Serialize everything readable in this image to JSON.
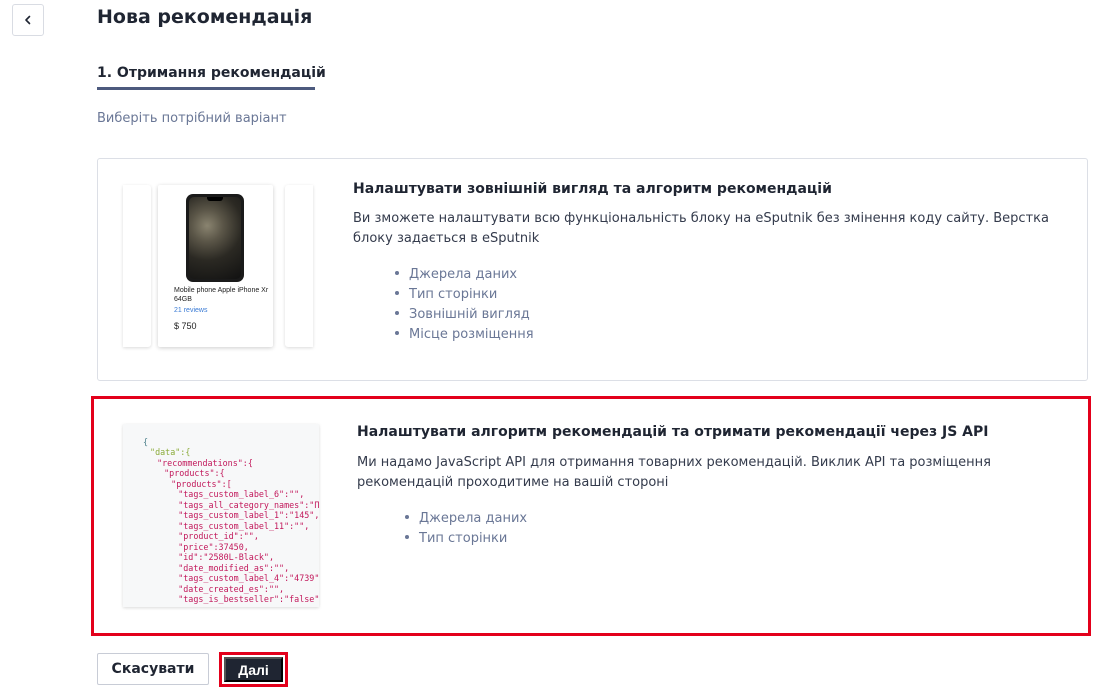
{
  "page": {
    "title": "Нова рекомендація",
    "step_tab": "1. Отримання рекомендацій",
    "hint": "Виберіть потрібний варіант"
  },
  "options": [
    {
      "title": "Налаштувати зовнішній вигляд та алгоритм рекомендацій",
      "description": "Ви зможете налаштувати всю функціональність блоку на eSputnik без змінення коду сайту. Верстка блоку задається в eSputnik",
      "features": [
        "Джерела даних",
        "Тип сторінки",
        "Зовнішній вигляд",
        "Місце розміщення"
      ],
      "preview": {
        "product_name": "Mobile phone Apple iPhone Xr 64GB",
        "reviews": "21 reviews",
        "price": "$ 750"
      }
    },
    {
      "title": "Налаштувати алгоритм рекомендацій та отримати рекомендації через JS API",
      "description": "Ми надамо JavaScript API для отримання товарних рекомендацій. Виклик API та розміщення рекомендацій проходитиме на вашій стороні",
      "features": [
        "Джерела даних",
        "Тип сторінки"
      ],
      "code_lines": [
        "{",
        " \"data\":{",
        "  \"recommendations\":{",
        "   \"products\":{",
        "    \"products\":[",
        "     \"tags_custom_label_6\":\"\",",
        "     \"tags_all_category_names\":\"Пу",
        "     \"tags_custom_label_1\":\"145\",",
        "     \"tags_custom_label_11\":\"\",",
        "     \"product_id\":\"\",",
        "     \"price\":37450,",
        "     \"id\":\"2580L-Black\",",
        "     \"date_modified_as\":\"\",",
        "     \"tags_custom_label_4\":\"4739\",",
        "     \"date_created_es\":\"\",",
        "     \"tags_is_bestseller\":\"false\""
      ]
    }
  ],
  "buttons": {
    "cancel": "Скасувати",
    "next": "Далі"
  },
  "colors": {
    "accent_dark": "#1f2532",
    "highlight": "#e3001b",
    "muted_text": "#6a7796"
  }
}
